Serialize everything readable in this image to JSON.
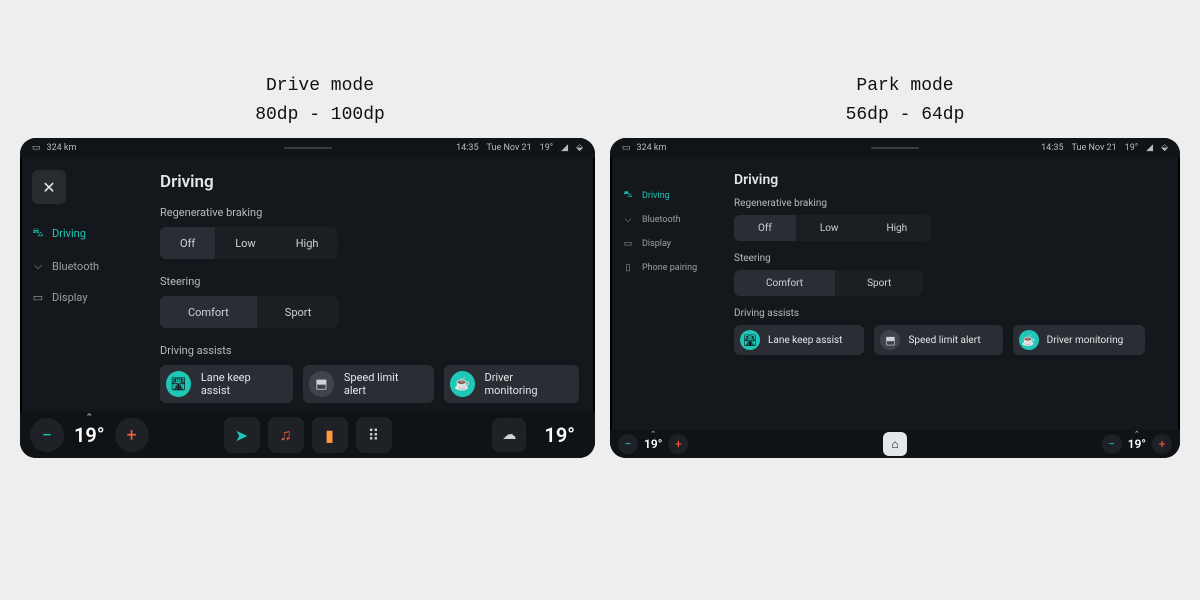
{
  "captions": {
    "drive": "Drive mode\n80dp - 100dp",
    "park": "Park mode\n56dp - 64dp"
  },
  "statusbar": {
    "range": "324 km",
    "time": "14:35",
    "date": "Tue Nov 21",
    "temp": "19°"
  },
  "sidebar": {
    "items": [
      "Driving",
      "Bluetooth",
      "Display",
      "Phone pairing"
    ],
    "active": "Driving"
  },
  "content": {
    "title": "Driving",
    "regen_label": "Regenerative braking",
    "regen_opts": [
      "Off",
      "Low",
      "High"
    ],
    "regen_sel": "Off",
    "steer_label": "Steering",
    "steer_opts": [
      "Comfort",
      "Sport"
    ],
    "steer_sel": "Comfort",
    "assists_label": "Driving assists",
    "assists": [
      {
        "label": "Lane keep assist",
        "on": true,
        "icon": "🛣"
      },
      {
        "label": "Speed limit alert",
        "on": false,
        "icon": "⬒"
      },
      {
        "label": "Driver monitoring",
        "on": true,
        "icon": "☕"
      }
    ]
  },
  "bottombar": {
    "temp_left": "19°",
    "temp_right": "19°"
  }
}
